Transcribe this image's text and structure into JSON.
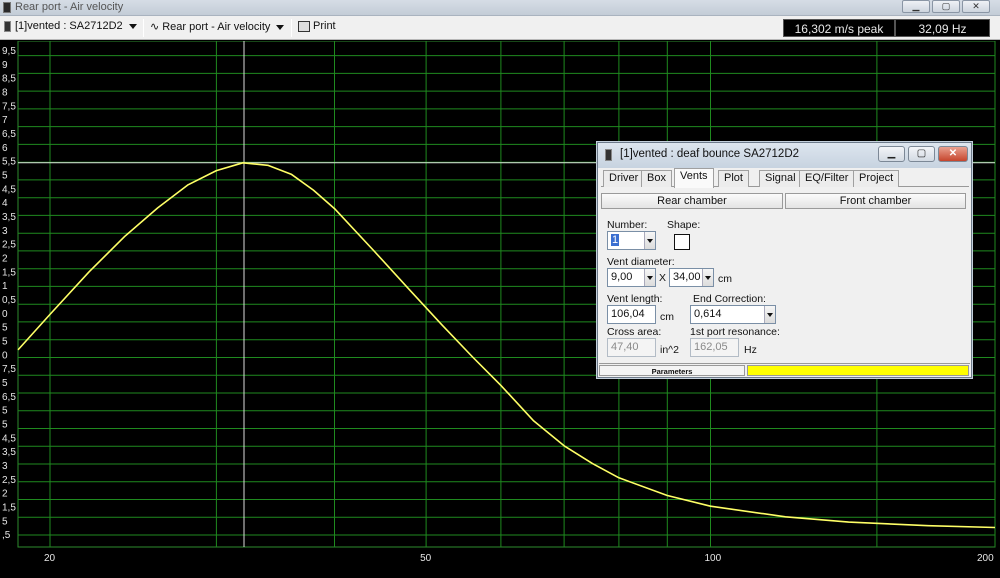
{
  "window": {
    "title": "Rear port - Air velocity",
    "minimize": "▁",
    "maximize": "▢",
    "close": "✕"
  },
  "toolbar": {
    "project_select": "[1]vented : SA2712D2",
    "graph_select": "Rear port - Air velocity",
    "print_label": "Print",
    "peak_readout": "16,302 m/s peak",
    "freq_readout": "32,09 Hz"
  },
  "chart_data": {
    "type": "line",
    "x_scale": "log",
    "xlim": [
      18.5,
      200
    ],
    "x_ticks": [
      {
        "value": 20,
        "label": "20"
      },
      {
        "value": 50,
        "label": "50"
      },
      {
        "value": 100,
        "label": "100"
      },
      {
        "value": 200,
        "label": "200"
      }
    ],
    "y_tick_labels": [
      "9,5",
      "9",
      "8,5",
      "8",
      "7,5",
      "7",
      "6,5",
      "6",
      "5,5",
      "5",
      "4,5",
      "4",
      "3,5",
      "3",
      "2,5",
      "2",
      "1,5",
      "1",
      "0,5",
      "0",
      "5",
      "5",
      "0",
      "7,5",
      "5",
      "6,5",
      "5",
      "5",
      "4,5",
      "3,5",
      "3",
      "2,5",
      "2",
      "1,5",
      "5",
      ",5"
    ],
    "series": [
      {
        "color": "#ffff66",
        "x": [
          18.5,
          20,
          22,
          24,
          26,
          28,
          30,
          32,
          34,
          36,
          38,
          40,
          44,
          48,
          52,
          56,
          60,
          65,
          70,
          75,
          80,
          90,
          100,
          120,
          140,
          170,
          200
        ],
        "y": [
          1.0,
          2.0,
          3.2,
          4.2,
          5.0,
          5.65,
          6.05,
          6.27,
          6.2,
          5.95,
          5.5,
          4.98,
          3.8,
          2.7,
          1.7,
          0.8,
          0.0,
          -1.0,
          -1.7,
          -2.2,
          -2.6,
          -3.1,
          -3.4,
          -3.7,
          -3.85,
          -3.95,
          -4.0
        ]
      }
    ],
    "cursor": {
      "x": 32.09,
      "y": 6.27
    }
  },
  "dialog": {
    "title": "[1]vented : deaf bounce SA2712D2",
    "tabs": [
      "Driver",
      "Box",
      "Vents",
      "Plot",
      "Signal",
      "EQ/Filter",
      "Project"
    ],
    "active_tab": "Vents",
    "rear_chamber": "Rear chamber",
    "front_chamber": "Front chamber",
    "number_label": "Number:",
    "number_value": "1",
    "shape_label": "Shape:",
    "vent_diameter_label": "Vent diameter:",
    "diameter_a": "9,00",
    "times": "X",
    "diameter_b": "34,00",
    "diameter_unit": "cm",
    "vent_length_label": "Vent length:",
    "vent_length_value": "106,04",
    "vent_length_unit": "cm",
    "end_correction_label": "End Correction:",
    "end_correction_value": "0,614",
    "cross_area_label": "Cross area:",
    "cross_area_value": "47,40",
    "cross_area_unit": "in^2",
    "port_resonance_label": "1st port resonance:",
    "port_resonance_value": "162,05",
    "port_resonance_unit": "Hz",
    "status_parameters": "Parameters",
    "status_color": "#ffff00"
  }
}
